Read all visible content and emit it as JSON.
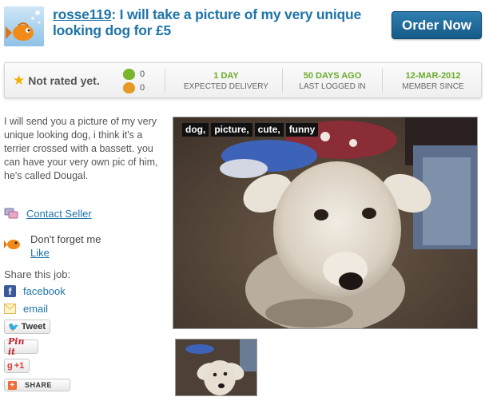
{
  "header": {
    "username": "rosse119",
    "title_rest": ": I will take a picture of my very unique looking dog for £5",
    "order_label": "Order Now"
  },
  "stats": {
    "rating_text": "Not rated yet.",
    "thumbs_up": "0",
    "thumbs_down": "0",
    "delivery_value": "1 DAY",
    "delivery_label": "EXPECTED DELIVERY",
    "login_value": "50 DAYS AGO",
    "login_label": "LAST LOGGED IN",
    "member_value": "12-MAR-2012",
    "member_label": "MEMBER SINCE"
  },
  "description": "I will send you a picture of my very unique looking dog, i think it's a terrier crossed with a bassett. you can have your very own pic of him, he's called Dougal.",
  "sidebar": {
    "contact": "Contact Seller",
    "forget": "Don't forget me",
    "like": "Like",
    "share_label": "Share this job:",
    "facebook": "facebook",
    "email": "email",
    "tweet": "Tweet",
    "pinit": "Pin it",
    "gplus": "+1",
    "share": "SHARE"
  },
  "photo": {
    "tags": [
      "dog,",
      "picture,",
      "cute,",
      "funny"
    ]
  },
  "colors": {
    "link": "#1f74a8",
    "accent_green": "#6aab2a",
    "order_button": "#155a87"
  }
}
